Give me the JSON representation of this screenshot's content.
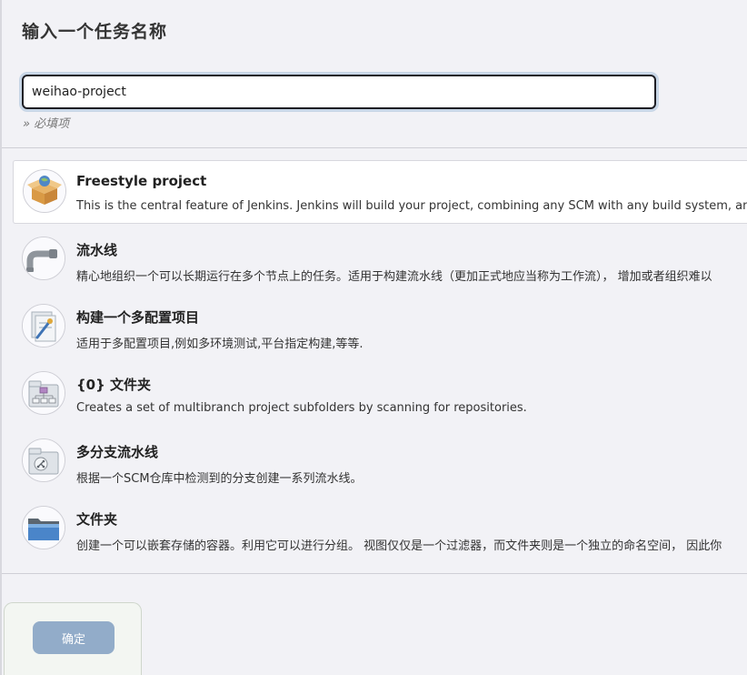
{
  "header": {
    "title": "输入一个任务名称",
    "input_value": "weihao-project",
    "required_hint": "» 必填项"
  },
  "items": [
    {
      "title": "Freestyle project",
      "description": "This is the central feature of Jenkins. Jenkins will build your project, combining any SCM with any build system, and this",
      "icon": "freestyle-box-icon",
      "selected": true
    },
    {
      "title": "流水线",
      "description": "精心地组织一个可以长期运行在多个节点上的任务。适用于构建流水线（更加正式地应当称为工作流）， 增加或者组织难以",
      "icon": "pipeline-icon",
      "selected": false
    },
    {
      "title": "构建一个多配置项目",
      "description": "适用于多配置项目,例如多环境测试,平台指定构建,等等.",
      "icon": "multi-config-icon",
      "selected": false
    },
    {
      "title": "{0} 文件夹",
      "description": "Creates a set of multibranch project subfolders by scanning for repositories.",
      "icon": "org-folder-icon",
      "selected": false
    },
    {
      "title": "多分支流水线",
      "description": "根据一个SCM仓库中检测到的分支创建一系列流水线。",
      "icon": "multibranch-icon",
      "selected": false
    },
    {
      "title": "文件夹",
      "description": "创建一个可以嵌套存储的容器。利用它可以进行分组。 视图仅仅是一个过滤器，而文件夹则是一个独立的命名空间， 因此你",
      "icon": "folder-icon",
      "selected": false
    }
  ],
  "footer": {
    "ok_label": "确定"
  },
  "colors": {
    "background": "#f2f2f6",
    "button": "#92acc9",
    "input_focus_ring": "#c8d6e6"
  }
}
